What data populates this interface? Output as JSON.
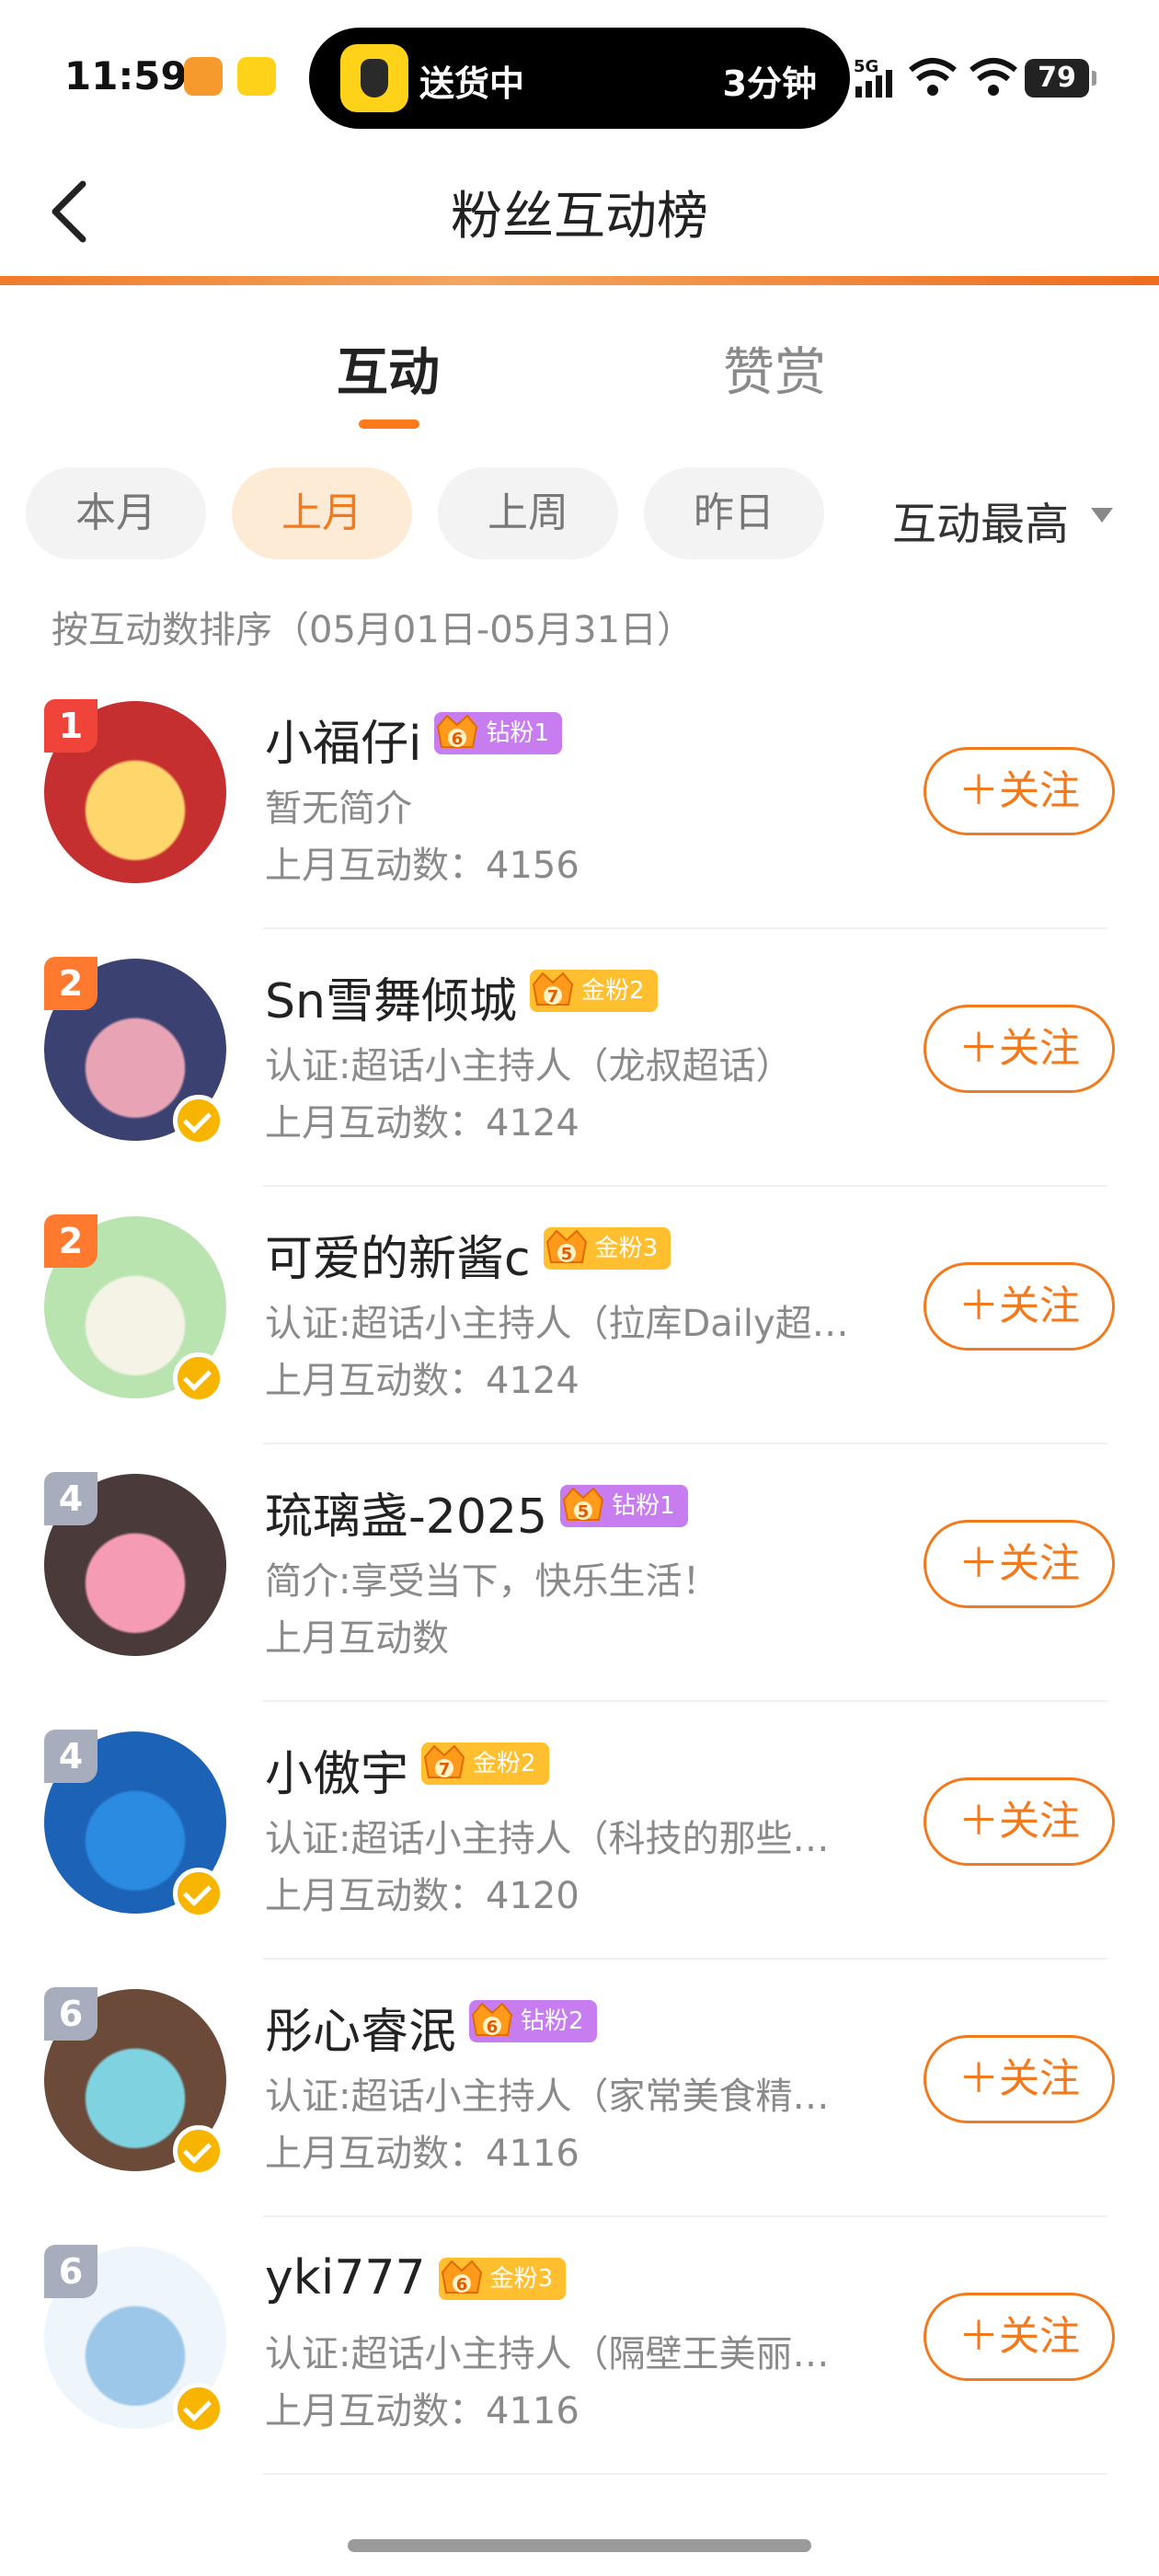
{
  "status_bar": {
    "time": "11:59",
    "activity_text": "送货中",
    "activity_eta": "3分钟",
    "network": "5G",
    "battery": "79"
  },
  "nav": {
    "title": "粉丝互动榜"
  },
  "tabs": [
    {
      "label": "互动",
      "active": true
    },
    {
      "label": "赞赏",
      "active": false
    }
  ],
  "filters": [
    {
      "label": "本月",
      "active": false
    },
    {
      "label": "上月",
      "active": true
    },
    {
      "label": "上周",
      "active": false
    },
    {
      "label": "昨日",
      "active": false
    }
  ],
  "sort": {
    "label": "互动最高"
  },
  "sort_hint": "按互动数排序（05月01日-05月31日）",
  "follow_label": "＋关注",
  "colors": {
    "accent": "#f2791c",
    "gold_badge": "#ffbf2e",
    "diamond_badge": "#c77df0"
  },
  "users": [
    {
      "rank": "1",
      "name": "小福仔i",
      "level": "6",
      "badge": "钻粉1",
      "badge_type": "diamond",
      "bio": "暂无简介",
      "count": "上月互动数：4156",
      "verified": false,
      "rank_color": "#f0433a",
      "avatar_colors": [
        "#c62f2f",
        "#ffd66b"
      ]
    },
    {
      "rank": "2",
      "name": "Sn雪舞倾城",
      "level": "7",
      "badge": "金粉2",
      "badge_type": "gold",
      "bio": "认证:超话小主持人（龙叔超话）",
      "count": "上月互动数：4124",
      "verified": true,
      "rank_color": "#ff7a2e",
      "avatar_colors": [
        "#3b4272",
        "#e8a3b4"
      ]
    },
    {
      "rank": "2",
      "name": "可爱的新酱c",
      "level": "5",
      "badge": "金粉3",
      "badge_type": "gold",
      "bio": "认证:超话小主持人（拉库Daily超…",
      "count": "上月互动数：4124",
      "verified": true,
      "rank_color": "#ff7a2e",
      "avatar_colors": [
        "#b9e4b0",
        "#f5f3e6"
      ]
    },
    {
      "rank": "4",
      "name": "琉璃盏-2025",
      "level": "5",
      "badge": "钻粉1",
      "badge_type": "diamond",
      "bio": "简介:享受当下，快乐生活！",
      "count": "上月互动数",
      "verified": false,
      "rank_color": "#a8adbd",
      "avatar_colors": [
        "#4a3a3a",
        "#f59bb3"
      ]
    },
    {
      "rank": "4",
      "name": "小傲宇",
      "level": "7",
      "badge": "金粉2",
      "badge_type": "gold",
      "bio": "认证:超话小主持人（科技的那些…",
      "count": "上月互动数：4120",
      "verified": true,
      "rank_color": "#a8adbd",
      "avatar_colors": [
        "#1c63b8",
        "#2a8be0"
      ]
    },
    {
      "rank": "6",
      "name": "彤心睿泯",
      "level": "6",
      "badge": "钻粉2",
      "badge_type": "diamond",
      "bio": "认证:超话小主持人（家常美食精…",
      "count": "上月互动数：4116",
      "verified": true,
      "rank_color": "#a8adbd",
      "avatar_colors": [
        "#6b4a3a",
        "#7fd3e0"
      ]
    },
    {
      "rank": "6",
      "name": "yki777",
      "level": "6",
      "badge": "金粉3",
      "badge_type": "gold",
      "bio": "认证:超话小主持人（隔壁王美丽…",
      "count": "上月互动数：4116",
      "verified": true,
      "rank_color": "#a8adbd",
      "avatar_colors": [
        "#eef5fb",
        "#9cc7e8"
      ]
    }
  ]
}
